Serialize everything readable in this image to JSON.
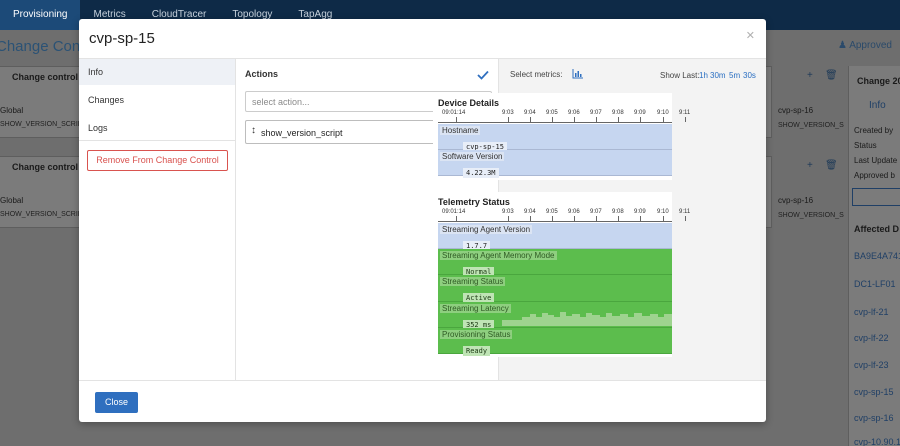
{
  "topnav": {
    "tabs": [
      "Provisioning",
      "Metrics",
      "CloudTracer",
      "Topology",
      "TapAgg"
    ],
    "active": "Provisioning"
  },
  "background": {
    "page_title": "Change Control",
    "approved": "Approved",
    "cards": [
      {
        "title": "Change control",
        "group": "Global",
        "script": "SHOW_VERSION_SCRIPT",
        "device": "cvp-sp-16",
        "device_script": "SHOW_VERSION_S"
      },
      {
        "title": "Change control",
        "group": "Global",
        "script": "SHOW_VERSION_SCRIPT",
        "device": "cvp-sp-16",
        "device_script": "SHOW_VERSION_S"
      }
    ],
    "right_panel": {
      "title": "Change 20",
      "tab": "Info",
      "fields": [
        "Created by",
        "Status",
        "Last Update",
        "Approved b"
      ],
      "affected_title": "Affected D",
      "devices": [
        "BA9E4A741",
        "DC1-LF01",
        "cvp-lf-21",
        "cvp-lf-22",
        "cvp-lf-23",
        "cvp-sp-15",
        "cvp-sp-16",
        "cvp-10.90.1"
      ]
    }
  },
  "modal": {
    "title": "cvp-sp-15",
    "sidebar": {
      "items": [
        "Info",
        "Changes",
        "Logs"
      ],
      "active": "Info",
      "remove_label": "Remove From Change Control"
    },
    "actions": {
      "title": "Actions",
      "select_placeholder": "select action...",
      "items": [
        {
          "label": "show_version_script"
        }
      ]
    },
    "metrics": {
      "select_label": "Select metrics:",
      "show_last_label": "Show Last:",
      "ranges": [
        "1h",
        "30m",
        "5m",
        "30s"
      ],
      "time_labels": [
        "09:01:14",
        "9:03",
        "9:04",
        "9:05",
        "9:06",
        "9:07",
        "9:08",
        "9:09",
        "9:10",
        "9:11"
      ],
      "device_details": {
        "title": "Device Details",
        "rows": [
          {
            "label": "Hostname",
            "value": "cvp-sp-15"
          },
          {
            "label": "Software Version",
            "value": "4.22.3M"
          }
        ]
      },
      "telemetry": {
        "title": "Telemetry Status",
        "rows": [
          {
            "label": "Streaming Agent Version",
            "value": "1.7.7",
            "status": "blue"
          },
          {
            "label": "Streaming Agent Memory Mode",
            "value": "Normal",
            "status": "green"
          },
          {
            "label": "Streaming Status",
            "value": "Active",
            "status": "green"
          },
          {
            "label": "Streaming Latency",
            "value": "352 ms",
            "status": "green"
          },
          {
            "label": "Provisioning Status",
            "value": "Ready",
            "status": "green"
          }
        ]
      }
    },
    "footer": {
      "close_label": "Close"
    }
  },
  "colors": {
    "primary": "#2f6fbf",
    "danger": "#d9534f",
    "navbar": "#0e2a47",
    "status_green": "#5cbd4d",
    "status_blue": "#c6d6f0"
  }
}
